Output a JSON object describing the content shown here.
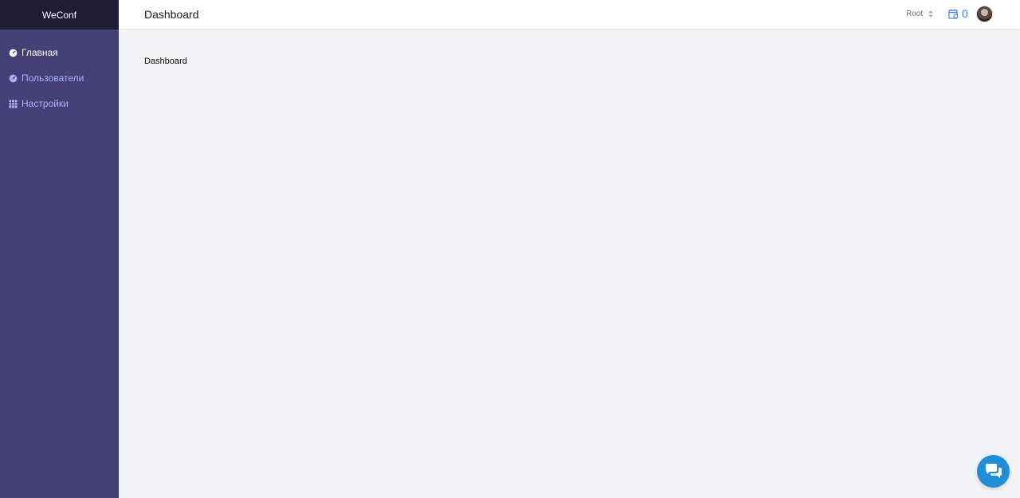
{
  "app": {
    "brand": "WeConf"
  },
  "sidebar": {
    "items": [
      {
        "label": "Главная",
        "icon": "dashboard-gauge-icon",
        "active": true
      },
      {
        "label": "Пользователи",
        "icon": "dashboard-gauge-icon",
        "active": false
      },
      {
        "label": "Настройки",
        "icon": "grid-table-icon",
        "active": false
      }
    ]
  },
  "header": {
    "title": "Dashboard",
    "team_select": "Root",
    "notification_count": "0",
    "notification_icon": "calendar-notification-icon",
    "avatar_icon": "user-avatar"
  },
  "main": {
    "content_text": "Dashboard"
  },
  "chat": {
    "icon": "chat-bubbles-icon"
  },
  "colors": {
    "sidebar_bg": "#453f78",
    "brand_bg": "#1f1d33",
    "nav_inactive": "#a9b0f5",
    "accent_blue": "#3b82f6",
    "chat_bg": "#1f8fd6",
    "content_bg": "#f1f3f6"
  }
}
